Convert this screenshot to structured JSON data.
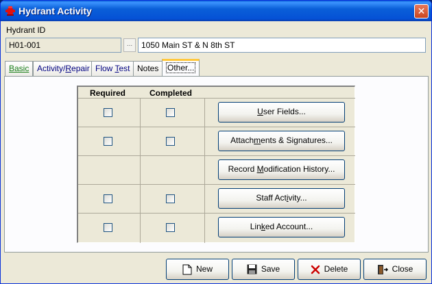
{
  "window": {
    "title": "Hydrant Activity",
    "close_glyph": "✕"
  },
  "hydrant": {
    "id_label": "Hydrant ID",
    "id_value": "H01-001",
    "browse_label": "...",
    "address": "1050 Main ST & N 8th ST"
  },
  "tabs": [
    {
      "label": "Basic",
      "color": "#1a7f1a"
    },
    {
      "pre": "Activity/",
      "acc": "R",
      "post": "epair",
      "color": "#000080"
    },
    {
      "pre": "Flow ",
      "acc": "T",
      "post": "est",
      "color": "#000080"
    },
    {
      "label": "Notes"
    },
    {
      "label": "Other...",
      "active": true
    }
  ],
  "grid": {
    "headers": {
      "required": "Required",
      "completed": "Completed"
    },
    "rows": [
      {
        "checkboxes": true,
        "button": {
          "pre": "",
          "acc": "U",
          "post": "ser Fields..."
        }
      },
      {
        "checkboxes": true,
        "button": {
          "pre": "Attach",
          "acc": "m",
          "post": "ents & Signatures..."
        }
      },
      {
        "checkboxes": false,
        "button": {
          "pre": "Record ",
          "acc": "M",
          "post": "odification History..."
        }
      },
      {
        "checkboxes": true,
        "button": {
          "pre": "Staff Act",
          "acc": "i",
          "post": "vity..."
        }
      },
      {
        "checkboxes": true,
        "button": {
          "pre": "Lin",
          "acc": "k",
          "post": "ed Account..."
        }
      }
    ]
  },
  "footer": {
    "new": "New",
    "save": "Save",
    "delete": "Delete",
    "close": "Close"
  },
  "icons": {
    "title": "fire-hydrant-icon",
    "new": "new-document-icon",
    "save": "floppy-disk-icon",
    "delete": "delete-x-icon",
    "close": "exit-door-icon"
  },
  "colors": {
    "titlebar": "#0a5fd8",
    "tab_active_accent": "#ffc83c",
    "delete_red": "#cc0000"
  }
}
